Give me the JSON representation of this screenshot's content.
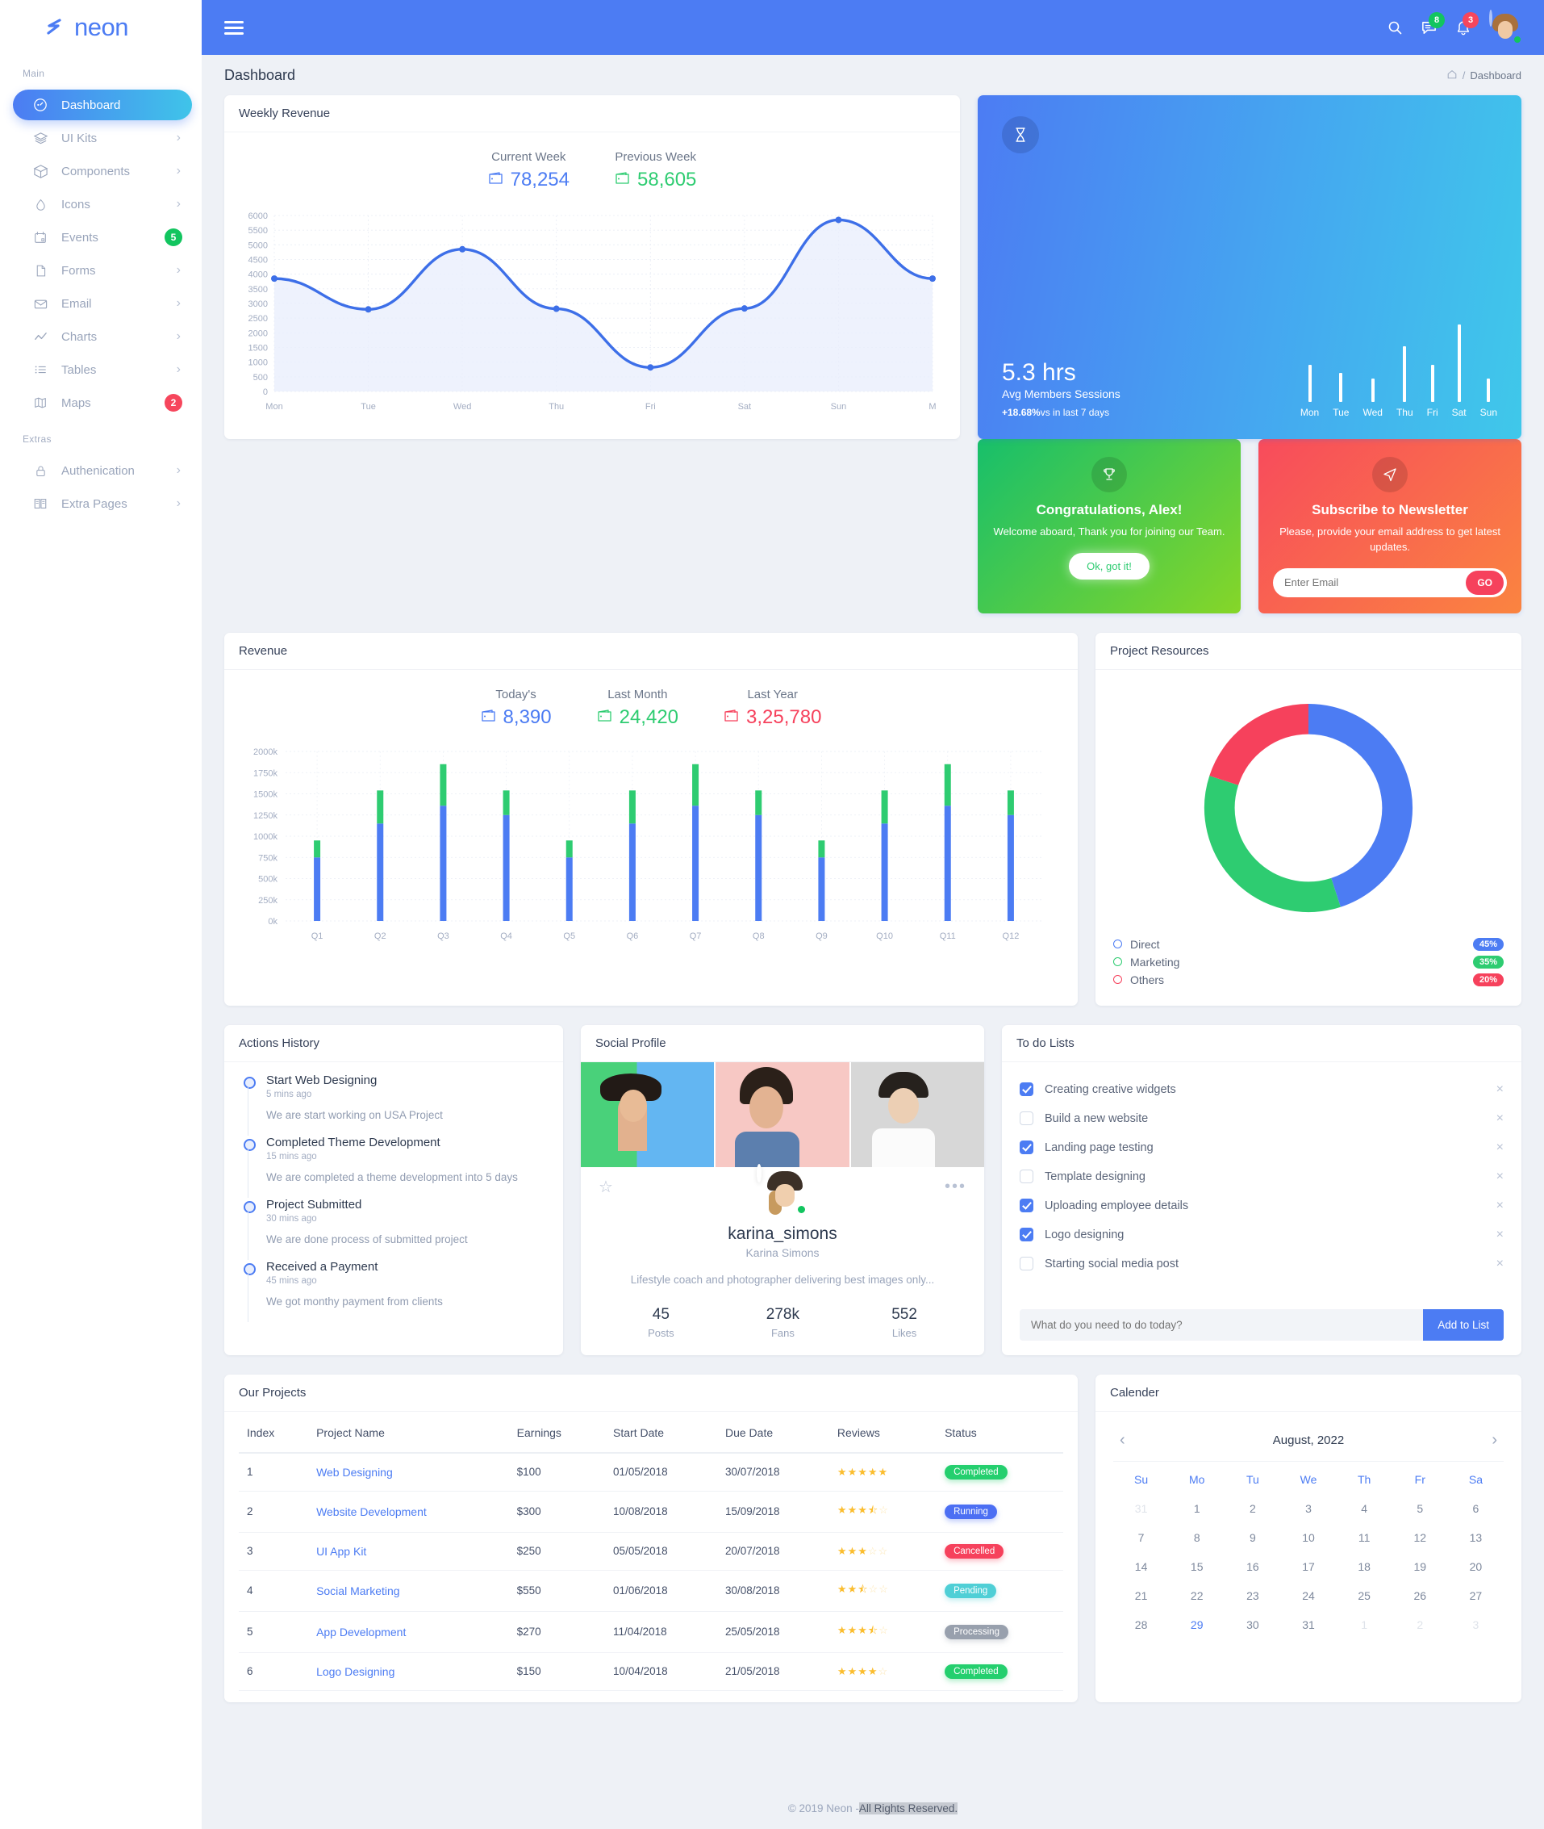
{
  "brand": {
    "name": "neon"
  },
  "sidebar": {
    "sections": [
      {
        "label": "Main",
        "items": [
          {
            "label": "Dashboard",
            "icon": "speedometer-icon",
            "active": true,
            "caret": false
          },
          {
            "label": "UI Kits",
            "icon": "layers-icon",
            "caret": true
          },
          {
            "label": "Components",
            "icon": "box-icon",
            "caret": true
          },
          {
            "label": "Icons",
            "icon": "droplet-icon",
            "caret": true
          },
          {
            "label": "Events",
            "icon": "calendar-icon",
            "badge": "5",
            "badge_color": "#12c55f"
          },
          {
            "label": "Forms",
            "icon": "file-icon",
            "caret": true
          },
          {
            "label": "Email",
            "icon": "envelope-icon",
            "caret": true
          },
          {
            "label": "Charts",
            "icon": "line-chart-icon",
            "caret": true
          },
          {
            "label": "Tables",
            "icon": "list-icon",
            "caret": true
          },
          {
            "label": "Maps",
            "icon": "map-icon",
            "badge": "2",
            "badge_color": "#f6465c"
          }
        ]
      },
      {
        "label": "Extras",
        "items": [
          {
            "label": "Authenication",
            "icon": "lock-icon",
            "caret": true
          },
          {
            "label": "Extra Pages",
            "icon": "book-icon",
            "caret": true
          }
        ]
      }
    ]
  },
  "topbar": {
    "menu_icon": "hamburger-icon",
    "search_icon": "search-icon",
    "messages_icon": "chat-icon",
    "messages_count": "8",
    "notifications_icon": "bell-icon",
    "notifications_count": "3",
    "avatar": "user-avatar"
  },
  "pagehead": {
    "title": "Dashboard",
    "home_icon": "home-icon",
    "separator": "/",
    "current": "Dashboard"
  },
  "weekly_revenue": {
    "card_title": "Weekly Revenue",
    "kpis": [
      {
        "label": "Current Week",
        "value": "78,254",
        "color": "#4c7cf3"
      },
      {
        "label": "Previous Week",
        "value": "58,605",
        "color": "#2ecc71"
      }
    ]
  },
  "sessions": {
    "icon": "hourglass-icon",
    "hours": "5.3 hrs",
    "subtitle": "Avg Members Sessions",
    "delta": "+18.68%",
    "delta_suffix": "vs in last 7 days"
  },
  "congrats": {
    "icon": "trophy-icon",
    "title": "Congratulations, Alex!",
    "subtitle": "Welcome aboard, Thank you for joining our Team.",
    "button": "Ok, got it!"
  },
  "newsletter": {
    "icon": "send-icon",
    "title": "Subscribe to Newsletter",
    "subtitle": "Please, provide your email address to get latest updates.",
    "placeholder": "Enter Email",
    "button": "GO"
  },
  "revenue": {
    "card_title": "Revenue",
    "kpis": [
      {
        "label": "Today's",
        "value": "8,390",
        "color": "#4c7cf3"
      },
      {
        "label": "Last Month",
        "value": "24,420",
        "color": "#2ecc71"
      },
      {
        "label": "Last Year",
        "value": "3,25,780",
        "color": "#f6415c"
      }
    ]
  },
  "project_resources": {
    "card_title": "Project Resources",
    "legend": [
      {
        "label": "Direct",
        "pct": "45%",
        "color": "#4c7cf3"
      },
      {
        "label": "Marketing",
        "pct": "35%",
        "color": "#2ecc71"
      },
      {
        "label": "Others",
        "pct": "20%",
        "color": "#f6415c"
      }
    ]
  },
  "actions_history": {
    "card_title": "Actions History",
    "items": [
      {
        "title": "Start Web Designing",
        "time": "5 mins ago",
        "desc": "We are start working on USA Project"
      },
      {
        "title": "Completed Theme Development",
        "time": "15 mins ago",
        "desc": "We are completed a theme development into 5 days"
      },
      {
        "title": "Project Submitted",
        "time": "30 mins ago",
        "desc": "We are done process of submitted project"
      },
      {
        "title": "Received a Payment",
        "time": "45 mins ago",
        "desc": "We got monthy payment from clients"
      }
    ]
  },
  "social_profile": {
    "card_title": "Social Profile",
    "star_icon": "star-outline-icon",
    "more_icon": "ellipsis-icon",
    "username": "karina_simons",
    "fullname": "Karina Simons",
    "bio": "Lifestyle coach and photographer delivering best images only...",
    "stats": [
      {
        "value": "45",
        "label": "Posts"
      },
      {
        "value": "278k",
        "label": "Fans"
      },
      {
        "value": "552",
        "label": "Likes"
      }
    ]
  },
  "todo": {
    "card_title": "To do Lists",
    "items": [
      {
        "label": "Creating creative widgets",
        "done": true
      },
      {
        "label": "Build a new website",
        "done": false
      },
      {
        "label": "Landing page testing",
        "done": true
      },
      {
        "label": "Template designing",
        "done": false
      },
      {
        "label": "Uploading employee details",
        "done": true
      },
      {
        "label": "Logo designing",
        "done": true
      },
      {
        "label": "Starting social media post",
        "done": false
      }
    ],
    "placeholder": "What do you need to do today?",
    "add_button": "Add to List",
    "remove_icon": "close-icon"
  },
  "projects": {
    "card_title": "Our Projects",
    "columns": [
      "Index",
      "Project Name",
      "Earnings",
      "Start Date",
      "Due Date",
      "Reviews",
      "Status"
    ],
    "rows": [
      {
        "index": "1",
        "name": "Web Designing",
        "earnings": "$100",
        "start": "01/05/2018",
        "due": "30/07/2018",
        "rating": 5,
        "status": "Completed",
        "status_class": "completed"
      },
      {
        "index": "2",
        "name": "Website Development",
        "earnings": "$300",
        "start": "10/08/2018",
        "due": "15/09/2018",
        "rating": 3.5,
        "status": "Running",
        "status_class": "running"
      },
      {
        "index": "3",
        "name": "UI App Kit",
        "earnings": "$250",
        "start": "05/05/2018",
        "due": "20/07/2018",
        "rating": 3,
        "status": "Cancelled",
        "status_class": "cancelled"
      },
      {
        "index": "4",
        "name": "Social Marketing",
        "earnings": "$550",
        "start": "01/06/2018",
        "due": "30/08/2018",
        "rating": 2.5,
        "status": "Pending",
        "status_class": "pending"
      },
      {
        "index": "5",
        "name": "App Development",
        "earnings": "$270",
        "start": "11/04/2018",
        "due": "25/05/2018",
        "rating": 3.5,
        "status": "Processing",
        "status_class": "processing"
      },
      {
        "index": "6",
        "name": "Logo Designing",
        "earnings": "$150",
        "start": "10/04/2018",
        "due": "21/05/2018",
        "rating": 4,
        "status": "Completed",
        "status_class": "completed"
      }
    ]
  },
  "calendar": {
    "card_title": "Calender",
    "prev_icon": "chevron-left-icon",
    "next_icon": "chevron-right-icon",
    "month": "August, 2022",
    "dow": [
      "Su",
      "Mo",
      "Tu",
      "We",
      "Th",
      "Fr",
      "Sa"
    ],
    "weeks": [
      [
        {
          "d": "31",
          "mut": true
        },
        {
          "d": "1"
        },
        {
          "d": "2"
        },
        {
          "d": "3"
        },
        {
          "d": "4"
        },
        {
          "d": "5"
        },
        {
          "d": "6"
        }
      ],
      [
        {
          "d": "7"
        },
        {
          "d": "8"
        },
        {
          "d": "9"
        },
        {
          "d": "10"
        },
        {
          "d": "11"
        },
        {
          "d": "12"
        },
        {
          "d": "13"
        }
      ],
      [
        {
          "d": "14"
        },
        {
          "d": "15"
        },
        {
          "d": "16"
        },
        {
          "d": "17"
        },
        {
          "d": "18"
        },
        {
          "d": "19"
        },
        {
          "d": "20"
        }
      ],
      [
        {
          "d": "21"
        },
        {
          "d": "22"
        },
        {
          "d": "23"
        },
        {
          "d": "24"
        },
        {
          "d": "25"
        },
        {
          "d": "26"
        },
        {
          "d": "27"
        }
      ],
      [
        {
          "d": "28"
        },
        {
          "d": "29",
          "sel": true
        },
        {
          "d": "30"
        },
        {
          "d": "31"
        },
        {
          "d": "1",
          "mut": true
        },
        {
          "d": "2",
          "mut": true
        },
        {
          "d": "3",
          "mut": true
        }
      ]
    ]
  },
  "footer": {
    "prefix": "© 2019 Neon - ",
    "highlight": "All Rights Reserved."
  },
  "chart_data": [
    {
      "type": "line",
      "title": "Weekly Revenue",
      "x": [
        "Mon",
        "Tue",
        "Wed",
        "Thu",
        "Fri",
        "Sat",
        "Sun",
        "M"
      ],
      "series": [
        {
          "name": "Current Week",
          "values": [
            3850,
            2800,
            4850,
            2820,
            820,
            2830,
            5850,
            3850
          ],
          "color": "#3d6fe8",
          "fill": "#e8eefc"
        }
      ],
      "ylim": [
        0,
        6000
      ],
      "yticks": [
        0,
        500,
        1000,
        1500,
        2000,
        2500,
        3000,
        3500,
        4000,
        4500,
        5000,
        5500,
        6000
      ],
      "xlabel": "",
      "ylabel": "",
      "grid": true,
      "legend": "none"
    },
    {
      "type": "bar",
      "title": "Avg Members Sessions",
      "categories": [
        "Mon",
        "Tue",
        "Wed",
        "Thu",
        "Fri",
        "Sat",
        "Sun"
      ],
      "values": [
        48,
        38,
        30,
        72,
        48,
        100,
        30
      ],
      "ylim": [
        0,
        100
      ],
      "color": "#ffffff",
      "xlabel": "",
      "ylabel": "",
      "grid": false,
      "legend": "none"
    },
    {
      "type": "bar",
      "title": "Revenue",
      "categories": [
        "Q1",
        "Q2",
        "Q3",
        "Q4",
        "Q5",
        "Q6",
        "Q7",
        "Q8",
        "Q9",
        "Q10",
        "Q11",
        "Q12"
      ],
      "stacked": true,
      "series": [
        {
          "name": "Base",
          "color": "#4c7cf3",
          "values": [
            750,
            1150,
            1360,
            1250,
            750,
            1150,
            1360,
            1250,
            750,
            1150,
            1360,
            1250
          ]
        },
        {
          "name": "Top",
          "color": "#2ecc71",
          "values": [
            200,
            390,
            490,
            290,
            200,
            390,
            490,
            290,
            200,
            390,
            490,
            290
          ]
        }
      ],
      "ylim": [
        0,
        2000
      ],
      "yticks": [
        0,
        250,
        500,
        750,
        1000,
        1250,
        1500,
        1750,
        2000
      ],
      "ytick_labels": [
        "0k",
        "250k",
        "500k",
        "750k",
        "1000k",
        "1250k",
        "1500k",
        "1750k",
        "2000k"
      ],
      "xlabel": "",
      "ylabel": "",
      "grid": true,
      "legend": "none"
    },
    {
      "type": "pie",
      "title": "Project Resources",
      "labels": [
        "Direct",
        "Marketing",
        "Others"
      ],
      "values": [
        45,
        35,
        20
      ],
      "colors": [
        "#4c7cf3",
        "#2ecc71",
        "#f6415c"
      ],
      "donut": true,
      "legend": "bottom-left"
    }
  ]
}
